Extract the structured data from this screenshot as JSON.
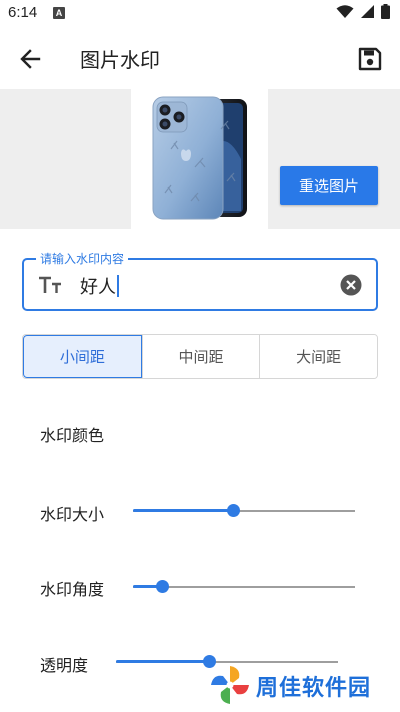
{
  "status_bar": {
    "time": "6:14",
    "notification_icon": "a-badge-icon",
    "icons": [
      "wifi-icon",
      "signal-icon",
      "battery-icon"
    ]
  },
  "app_bar": {
    "back_icon": "arrow-left-icon",
    "title": "图片水印",
    "save_icon": "floppy-disk-icon"
  },
  "preview": {
    "image": "phone-photo-with-watermark",
    "reselect_label": "重选图片"
  },
  "watermark_input": {
    "label": "请输入水印内容",
    "value": "好人",
    "leading_icon": "text-format-icon",
    "trailing_icon": "clear-circle-icon"
  },
  "spacing": {
    "options": [
      "小间距",
      "中间距",
      "大间距"
    ],
    "selected": "小间距"
  },
  "settings": {
    "color_label": "水印颜色",
    "size_label": "水印大小",
    "size_value": 0.45,
    "angle_label": "水印角度",
    "angle_value": 0.13,
    "opacity_label": "透明度",
    "opacity_value": 0.42
  },
  "brand": {
    "text": "周佳软件园",
    "accent": "#1e6fd9"
  },
  "colors": {
    "accent": "#2f7be3",
    "button": "#2979e8",
    "panel_bg": "#eeeeee"
  }
}
